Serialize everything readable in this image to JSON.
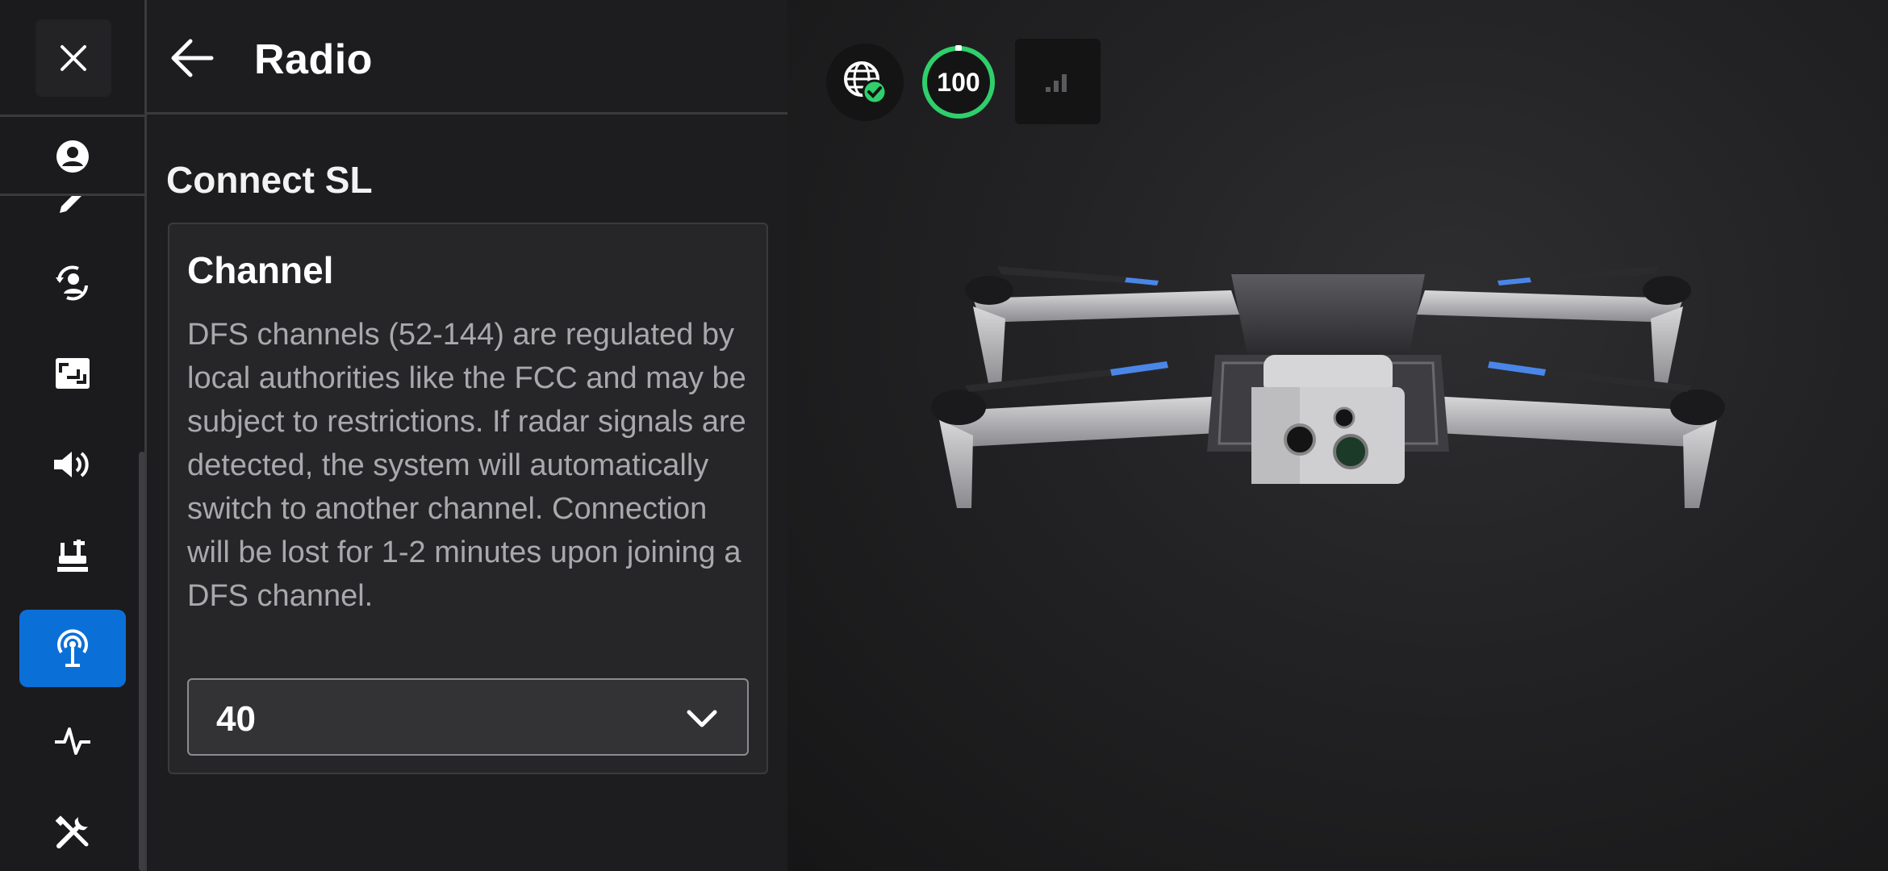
{
  "header": {
    "title": "Radio",
    "back_icon": "arrow-left-icon",
    "close_icon": "close-icon"
  },
  "nav": {
    "items": [
      {
        "name": "account",
        "icon": "account-icon"
      },
      {
        "name": "pencil",
        "icon": "pencil-icon"
      },
      {
        "name": "users-sync",
        "icon": "user-sync-icon"
      },
      {
        "name": "display",
        "icon": "display-icon"
      },
      {
        "name": "sound",
        "icon": "speaker-icon"
      },
      {
        "name": "controller",
        "icon": "controller-icon"
      },
      {
        "name": "radio",
        "icon": "radio-antenna-icon",
        "active": true
      },
      {
        "name": "activity",
        "icon": "activity-pulse-icon"
      },
      {
        "name": "tools",
        "icon": "tools-icon"
      }
    ],
    "active_color": "#0b6fd8"
  },
  "section": {
    "title": "Connect SL"
  },
  "channel": {
    "title": "Channel",
    "description": "DFS channels (52-144) are regulated by local authorities like the FCC and may be subject to restrictions. If radar signals are detected, the system will automatically switch to another channel. Connection will be lost for 1-2 minutes upon joining a DFS channel.",
    "selected": "40"
  },
  "status": {
    "gps_icon": "globe-check-icon",
    "battery_percent": "100",
    "battery_color": "#2fcf6b",
    "signal_icon": "signal-bars-icon"
  }
}
